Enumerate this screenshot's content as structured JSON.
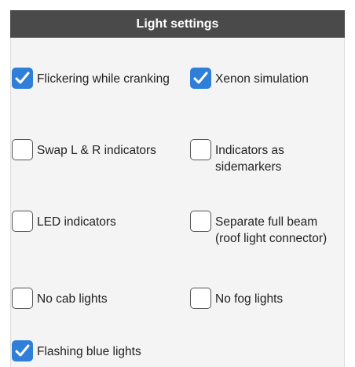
{
  "header": {
    "title": "Light settings"
  },
  "options": [
    {
      "id": "flickering",
      "label": "Flickering while cranking",
      "checked": true
    },
    {
      "id": "xenon",
      "label": "Xenon simulation",
      "checked": true
    },
    {
      "id": "swap-indicators",
      "label": "Swap L & R indicators",
      "checked": false
    },
    {
      "id": "indicators-sidemarkers",
      "label": "Indicators as sidemarkers",
      "checked": false
    },
    {
      "id": "led-indicators",
      "label": "LED indicators",
      "checked": false
    },
    {
      "id": "separate-full-beam",
      "label": "Separate full beam (roof light connector)",
      "checked": false
    },
    {
      "id": "no-cab-lights",
      "label": "No cab lights",
      "checked": false
    },
    {
      "id": "no-fog-lights",
      "label": "No fog lights",
      "checked": false
    },
    {
      "id": "flashing-blue",
      "label": "Flashing blue lights",
      "checked": true
    }
  ],
  "colors": {
    "header_bg": "#4a4a4a",
    "panel_bg": "#f4f4f4",
    "checkbox_checked": "#2f7fd9"
  }
}
